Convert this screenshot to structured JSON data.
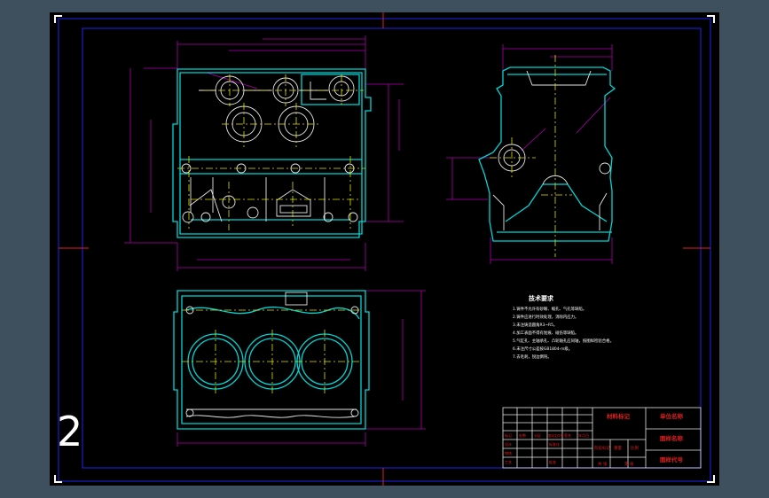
{
  "sheet": {
    "corner_number": "2",
    "tech_title": "技术要求",
    "tech_lines": [
      "1.铸件不允许有砂眼、缩孔、气孔等缺陷。",
      "2.铸件应进行时效处理，消除内应力。",
      "3.未注铸造圆角R3~R5。",
      "4.加工表面不得有划痕、碰伤等缺陷。",
      "5.气缸孔、主轴承孔、凸轮轴孔应同轴，按图样检验合格。",
      "6.未注尺寸公差按GB1804-m级。",
      "7.去毛刺，锐边倒钝。"
    ]
  },
  "title_block": {
    "material_label": "材料标记",
    "unit_name_label": "单位名称",
    "drawing_name_label": "图样名称",
    "drawing_code_label": "图样代号",
    "stage_mark_label": "阶段标记",
    "weight_label": "重量",
    "scale_label": "比例",
    "sheet_count_label": "共 张",
    "sheet_no_label": "第 张",
    "revision_header": [
      "标记",
      "处数",
      "分区",
      "更改文件号",
      "签名",
      "年月日"
    ],
    "role_labels": [
      "设计",
      "审核",
      "工艺",
      "批准"
    ],
    "standardize_label": "标准化"
  },
  "colors": {
    "background": "#3e4f5e",
    "sheet": "#000000",
    "border": "#1a1fc9",
    "outline": "#00d6d6",
    "part_lines": "#e6e6e6",
    "center_lines": "#e2e200",
    "dimensions": "#b000b0",
    "frame_red": "#e02020",
    "text": "#ffffff"
  }
}
